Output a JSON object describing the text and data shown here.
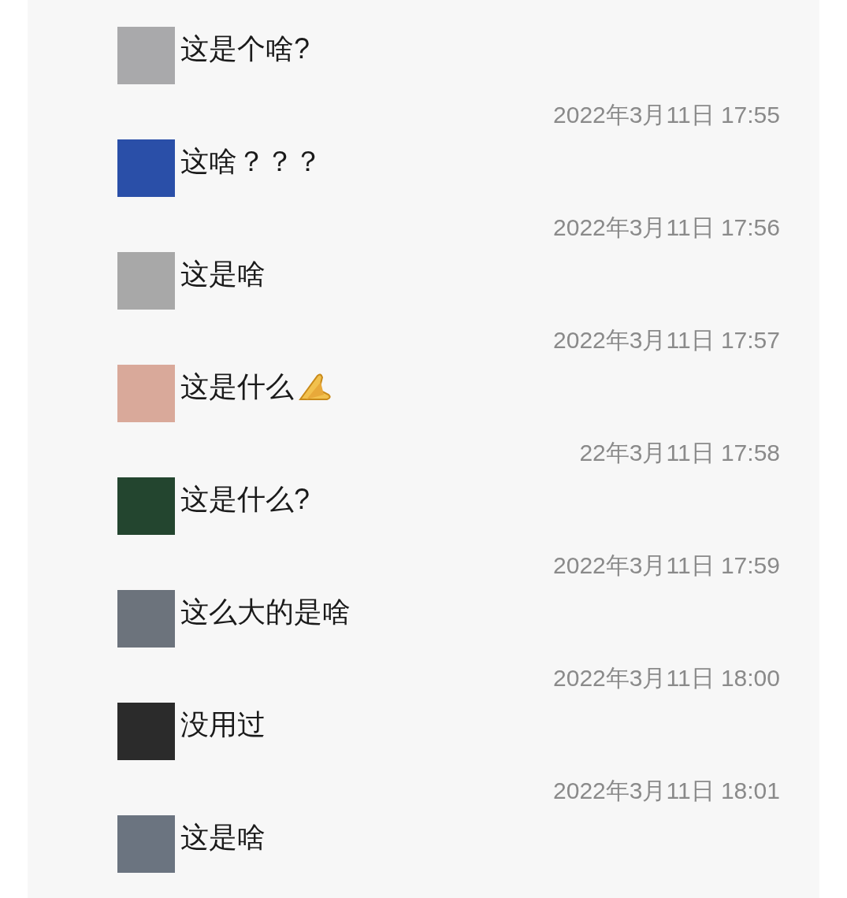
{
  "messages": [
    {
      "text": "这是个啥?",
      "color": "#a9a9ab",
      "emoji": false
    },
    {
      "time": "2022年3月11日 17:55",
      "text": "这啥？？？",
      "color": "#2a4fa8",
      "emoji": false
    },
    {
      "time": "2022年3月11日 17:56",
      "text": "这是啥",
      "color": "#a8a8a8",
      "emoji": false
    },
    {
      "time": "2022年3月11日 17:57",
      "text": "这是什么",
      "color": "#d9a99a",
      "emoji": true
    },
    {
      "time": "22年3月11日 17:58",
      "text": "这是什么?",
      "color": "#23452f",
      "emoji": false
    },
    {
      "time": "2022年3月11日 17:59",
      "text": "这么大的是啥",
      "color": "#6c737c",
      "emoji": false
    },
    {
      "time": "2022年3月11日 18:00",
      "text": "没用过",
      "color": "#2b2b2b",
      "emoji": false
    },
    {
      "time": "2022年3月11日 18:01",
      "text": "这是啥",
      "color": "#6b7480",
      "emoji": false
    }
  ]
}
